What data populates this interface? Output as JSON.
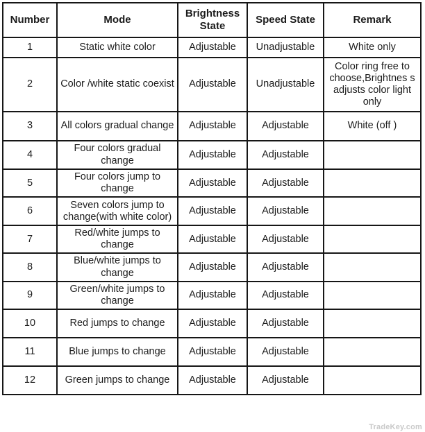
{
  "table": {
    "columns": [
      {
        "key": "number",
        "label": "Number"
      },
      {
        "key": "mode",
        "label": "Mode"
      },
      {
        "key": "brightness",
        "label": "Brightness State"
      },
      {
        "key": "speed",
        "label": "Speed State"
      },
      {
        "key": "remark",
        "label": "Remark"
      }
    ],
    "header": {
      "number": "Number",
      "mode": "Mode",
      "brightness_line1": "Brightness",
      "brightness_line2": "State",
      "speed": "Speed State",
      "remark": "Remark"
    },
    "rows": [
      {
        "number": "1",
        "mode": "Static white color",
        "brightness": "Adjustable",
        "speed": "Unadjustable",
        "remark": "White only"
      },
      {
        "number": "2",
        "mode": "Color /white static coexist",
        "brightness": "Adjustable",
        "speed": "Unadjustable",
        "remark": "Color ring free to choose,Brightnes s adjusts color light only"
      },
      {
        "number": "3",
        "mode": "All colors gradual change",
        "brightness": "Adjustable",
        "speed": "Adjustable",
        "remark": "White (off )"
      },
      {
        "number": "4",
        "mode": "Four colors gradual change",
        "brightness": "Adjustable",
        "speed": "Adjustable",
        "remark": ""
      },
      {
        "number": "5",
        "mode": "Four colors jump to change",
        "brightness": "Adjustable",
        "speed": "Adjustable",
        "remark": ""
      },
      {
        "number": "6",
        "mode": "Seven colors jump to change(with white color)",
        "brightness": "Adjustable",
        "speed": "Adjustable",
        "remark": ""
      },
      {
        "number": "7",
        "mode": "Red/white jumps to change",
        "brightness": "Adjustable",
        "speed": "Adjustable",
        "remark": ""
      },
      {
        "number": "8",
        "mode": "Blue/white jumps to change",
        "brightness": "Adjustable",
        "speed": "Adjustable",
        "remark": ""
      },
      {
        "number": "9",
        "mode": "Green/white jumps to change",
        "brightness": "Adjustable",
        "speed": "Adjustable",
        "remark": ""
      },
      {
        "number": "10",
        "mode": "Red jumps to change",
        "brightness": "Adjustable",
        "speed": "Adjustable",
        "remark": ""
      },
      {
        "number": "11",
        "mode": "Blue jumps to change",
        "brightness": "Adjustable",
        "speed": "Adjustable",
        "remark": ""
      },
      {
        "number": "12",
        "mode": "Green jumps to change",
        "brightness": "Adjustable",
        "speed": "Adjustable",
        "remark": ""
      }
    ]
  },
  "watermark": {
    "text": "TradeKey.com"
  },
  "colors": {
    "border": "#161616",
    "text": "#1c1c1c",
    "background": "#ffffff",
    "watermark": "#c9c9c9"
  }
}
